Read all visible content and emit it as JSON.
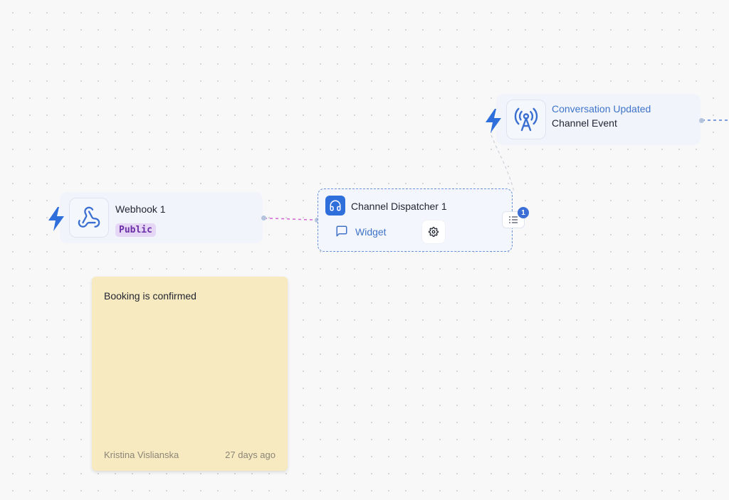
{
  "nodes": {
    "webhook": {
      "title": "Webhook 1",
      "badge": "Public"
    },
    "event": {
      "title": "Conversation Updated",
      "subtitle": "Channel Event"
    },
    "dispatcher": {
      "title": "Channel Dispatcher 1",
      "channel": "Widget",
      "count": "1"
    }
  },
  "sticky": {
    "text": "Booking is confirmed",
    "author": "Kristina Vislianska",
    "time": "27 days ago"
  },
  "icons": {
    "trigger": "lightning-bolt-icon",
    "webhook": "webhook-icon",
    "broadcast": "broadcast-tower-icon",
    "headset": "headset-icon",
    "chat": "chat-bubble-icon",
    "settings": "gear-icon",
    "list": "list-icon"
  },
  "colors": {
    "accent": "#3f73c9",
    "badge_bg": "#e6d6f6",
    "badge_text": "#6b2fa6",
    "sticky": "#f8eac0",
    "wire_pink": "#d66bd6"
  }
}
